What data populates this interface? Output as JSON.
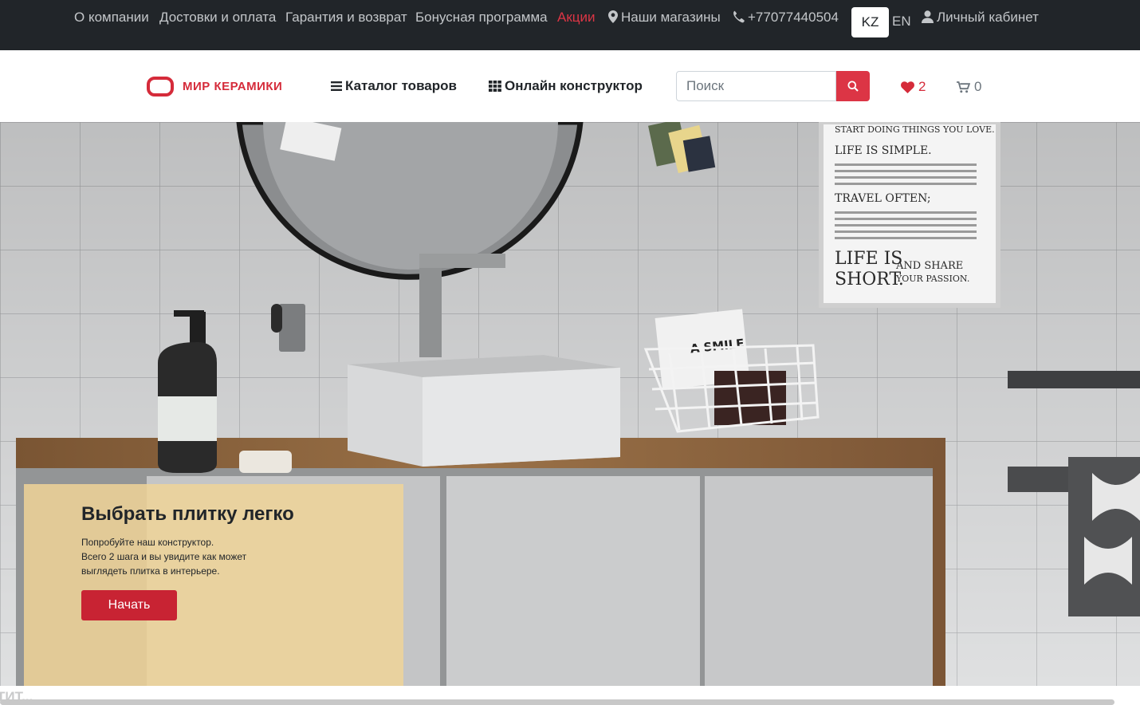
{
  "topbar": {
    "about": "О компании",
    "delivery": "Достовки и оплата",
    "warranty": "Гарантия и возврат",
    "bonus": "Бонусная программа",
    "promo": "Акции",
    "stores": "Наши магазины",
    "phone": "+77077440504",
    "lang_kz": "KZ",
    "lang_en": "EN",
    "account": "Личный кабинет"
  },
  "header": {
    "logo_text": "МИР КЕРАМИКИ",
    "catalog": "Каталог товаров",
    "constructor": "Онлайн конструктор",
    "search_placeholder": "Поиск",
    "favorites_count": "2",
    "cart_count": "0"
  },
  "hero": {
    "poster_lines": [
      "START DOING THINGS YOU LOVE.",
      "LIFE IS SIMPLE.",
      "TRAVEL OFTEN;",
      "LIFE IS",
      "SHORT.",
      "AND SHARE",
      "YOUR PASSION."
    ],
    "book_text": "A SMILE",
    "promo_title": "Выбрать плитку легко",
    "promo_line1": "Попробуйте наш конструктор.",
    "promo_line2": "Всего 2 шага и вы увидите как может",
    "promo_line3": "выглядеть плитка в интерьере.",
    "start_button": "Начать"
  },
  "below_fold_text": "ТИТ...",
  "colors": {
    "brand_red": "#d52b3a",
    "topbar_bg": "#212529",
    "promo_card": "#f0d398"
  },
  "icons": {
    "stores": "map-marker-icon",
    "phone": "phone-icon",
    "account": "user-icon",
    "catalog": "menu-icon",
    "constructor": "grid-icon",
    "search": "search-icon",
    "favorites": "heart-icon",
    "cart": "cart-icon"
  }
}
